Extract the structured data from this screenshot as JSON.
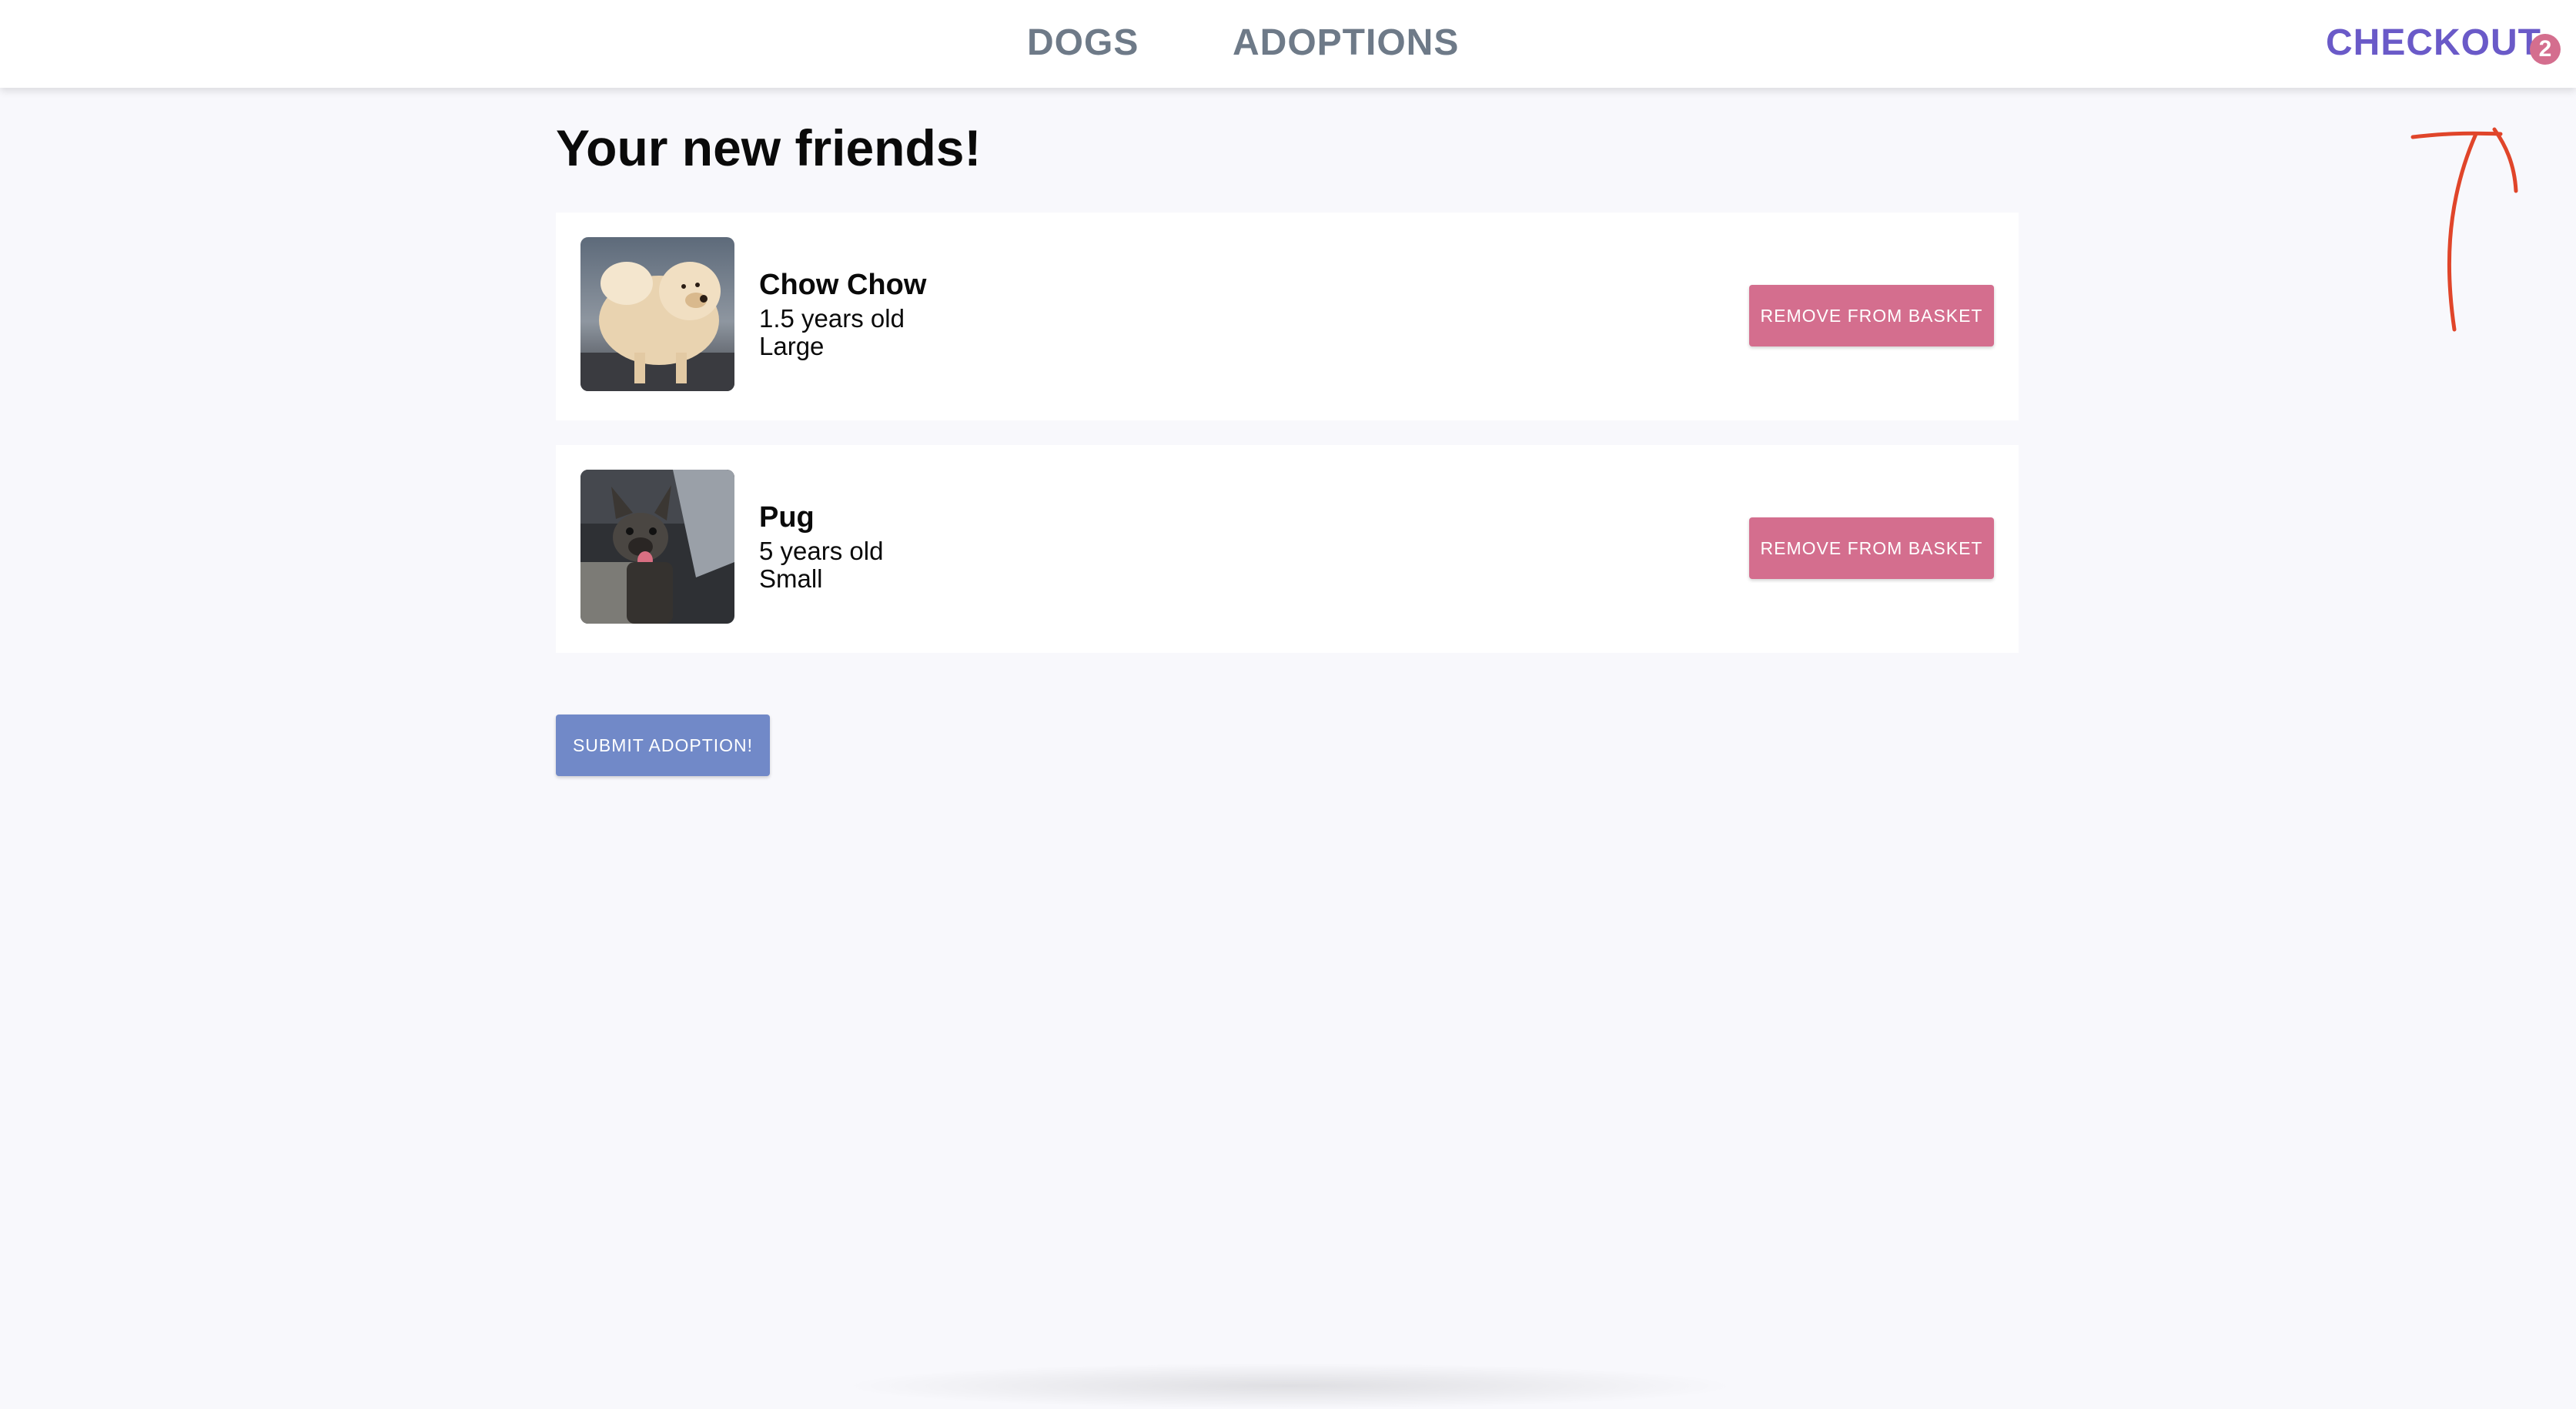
{
  "nav": {
    "dogs_label": "DOGS",
    "adoptions_label": "ADOPTIONS",
    "checkout_label": "CHECKOUT",
    "checkout_count": "2"
  },
  "page": {
    "title": "Your new friends!"
  },
  "basket": {
    "items": [
      {
        "name": "Chow Chow",
        "age": "1.5 years old",
        "size": "Large",
        "image": "chow-chow-photo",
        "remove_label": "REMOVE FROM BASKET"
      },
      {
        "name": "Pug",
        "age": "5 years old",
        "size": "Small",
        "image": "pug-photo",
        "remove_label": "REMOVE FROM BASKET"
      }
    ]
  },
  "actions": {
    "submit_label": "SUBMIT ADOPTION!"
  },
  "colors": {
    "background": "#f8f8fc",
    "nav_text": "#6e7a88",
    "checkout_accent": "#6a5ac8",
    "badge": "#d46e8e",
    "remove_button": "#d46e8e",
    "submit_button": "#7189c8",
    "annotation_arrow": "#e0452a"
  },
  "icons": {
    "annotation": "arrow-up-annotation-icon"
  }
}
